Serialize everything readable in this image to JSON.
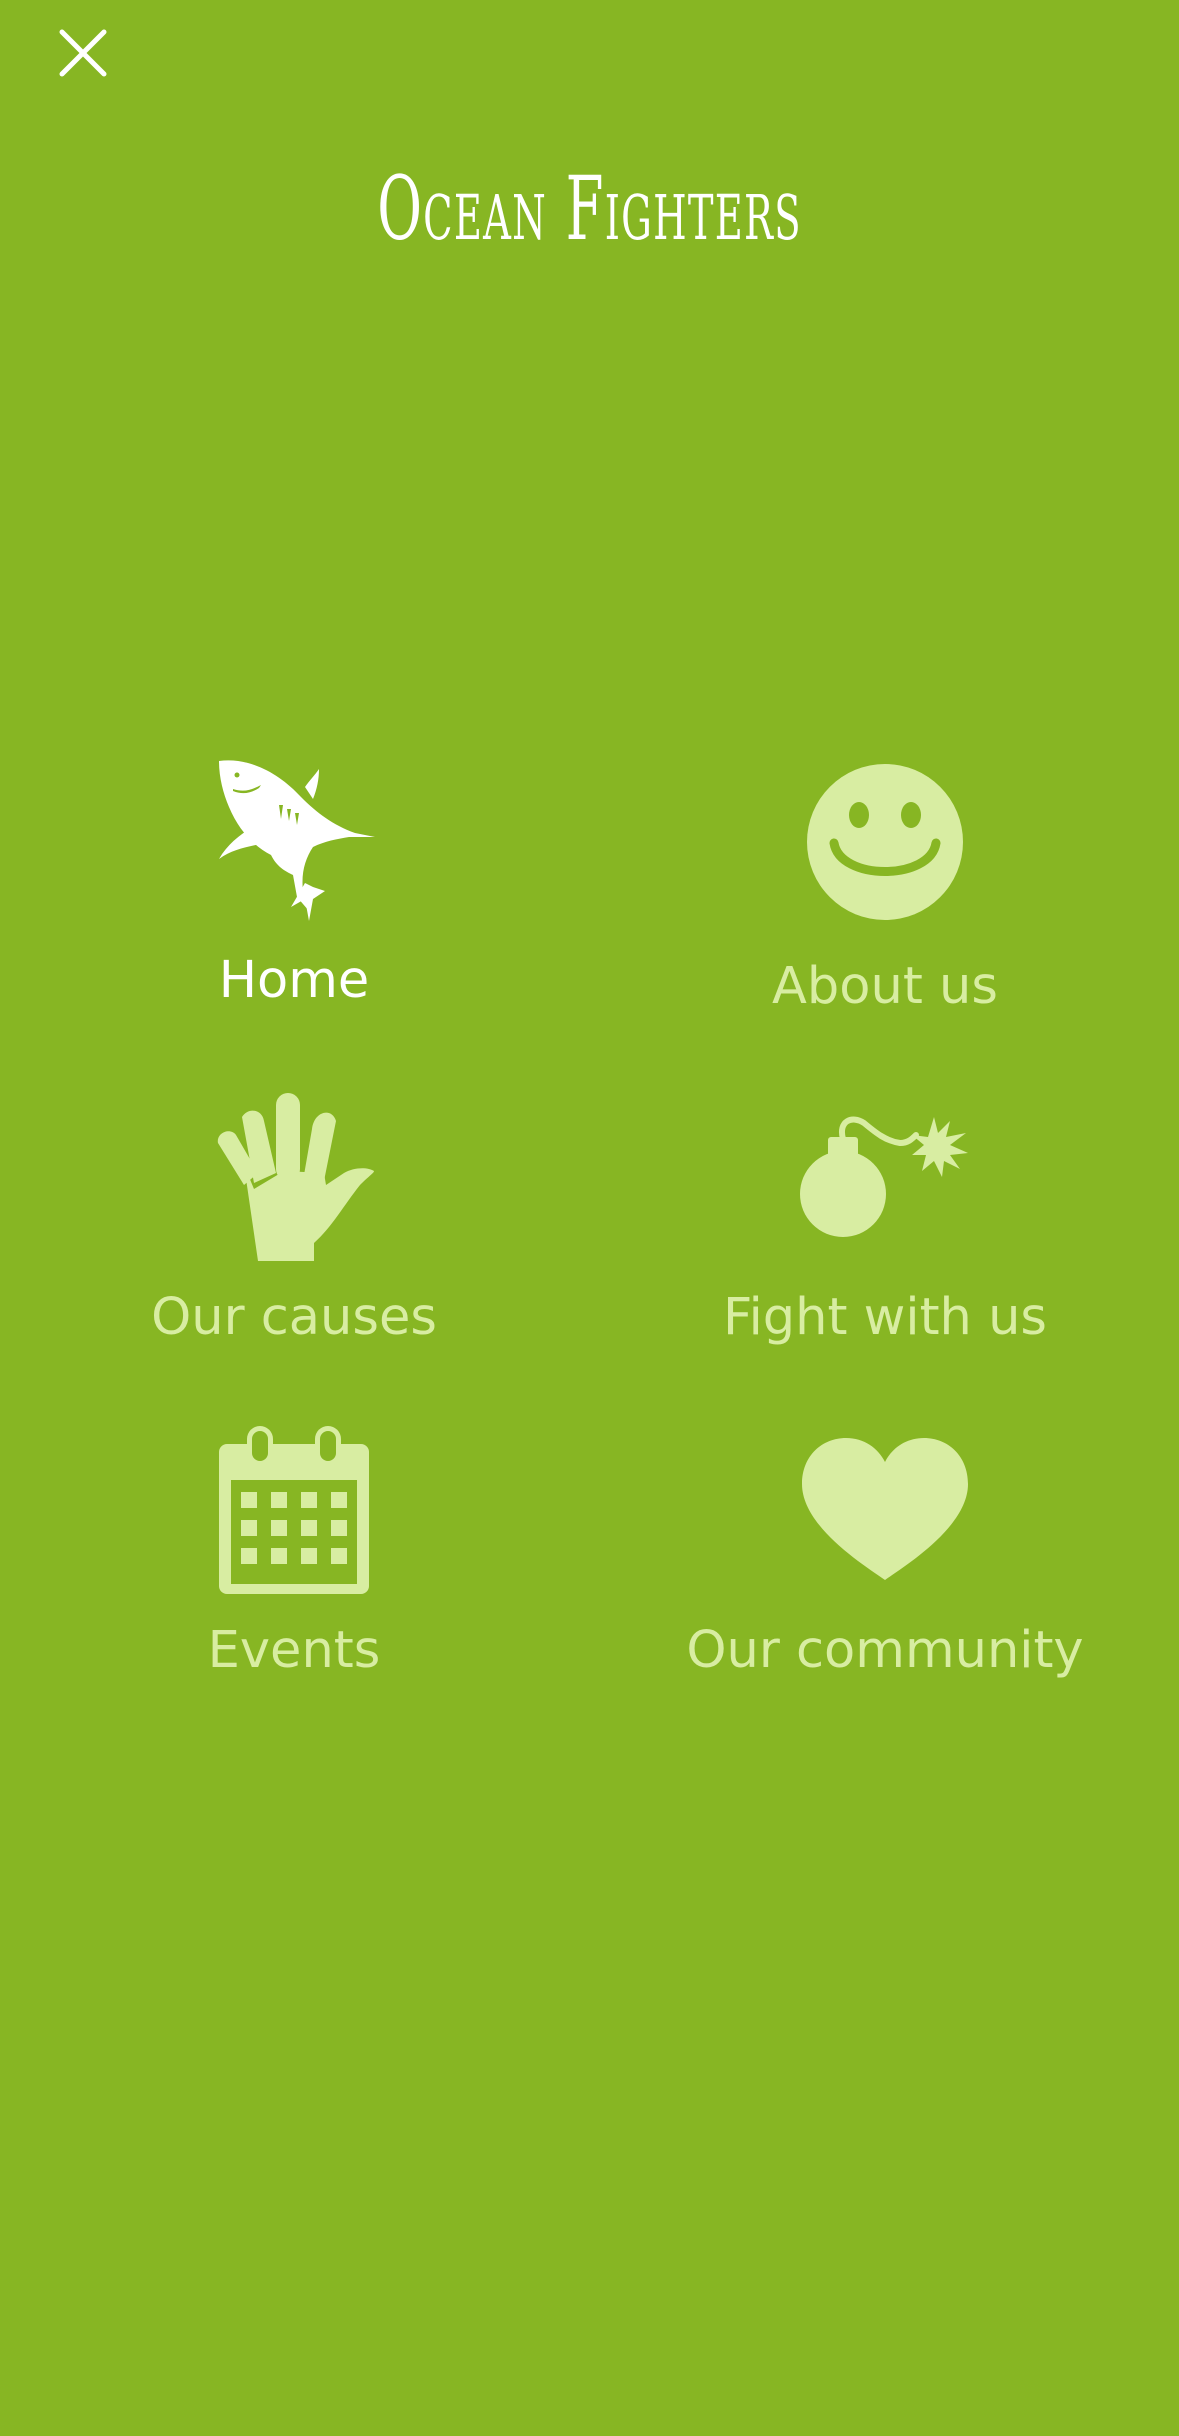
{
  "header": {
    "title": "Ocean Fighters",
    "close_icon": "close-icon"
  },
  "colors": {
    "background": "#87b623",
    "label": "#d8eda2",
    "active": "#ffffff"
  },
  "menu": {
    "items": [
      {
        "label": "Home",
        "icon": "shark-icon",
        "active": true
      },
      {
        "label": "About us",
        "icon": "smiley-icon",
        "active": false
      },
      {
        "label": "Our causes",
        "icon": "hand-icon",
        "active": false
      },
      {
        "label": "Fight with us",
        "icon": "bomb-icon",
        "active": false
      },
      {
        "label": "Events",
        "icon": "calendar-icon",
        "active": false
      },
      {
        "label": "Our community",
        "icon": "heart-icon",
        "active": false
      }
    ]
  }
}
